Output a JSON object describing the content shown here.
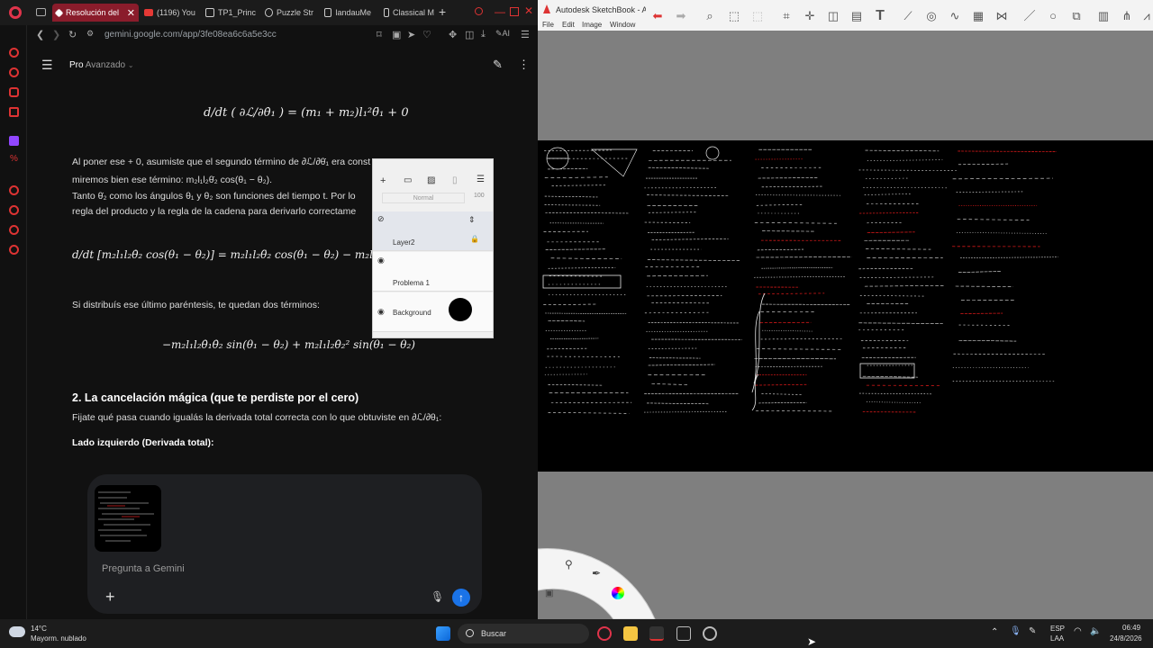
{
  "browser": {
    "tabs": [
      {
        "label": "Resolución del"
      },
      {
        "label": "(1196) You"
      },
      {
        "label": "TP1_Princ"
      },
      {
        "label": "Puzzle Str"
      },
      {
        "label": "landauMe"
      },
      {
        "label": "Classical M"
      }
    ],
    "url": "gemini.google.com/app/3fe08ea6c6a5e3cc",
    "ai_label": "AI"
  },
  "gemini": {
    "model_pro": "Pro",
    "model_mode": "Avanzado",
    "eq1": "d/dt ( ∂ℒ/∂θ̇₁ ) = (m₁ + m₂)l₁²θ̈₁ + 0",
    "p1_line1": "Al poner ese + 0, asumiste que el segundo término de ∂ℒ/∂θ̇₁ era const",
    "p1_line2": "miremos bien ese término: m₂l₁l₂θ̇₂ cos(θ₁ − θ₂).",
    "p1_line3": "Tanto θ̇₂ como los ángulos θ₁ y θ₂ son funciones del tiempo t. Por lo",
    "p1_line4": "regla del producto y la regla de la cadena para derivarlo correctame",
    "eq2": "d/dt [m₂l₁l₂θ̇₂ cos(θ₁ − θ₂)] = m₂l₁l₂θ̈₂ cos(θ₁ − θ₂) − m₂l₁l₂",
    "p2": "Si distribuís ese último paréntesis, te quedan dos términos:",
    "eq3": "−m₂l₁l₂θ̇₁θ̇₂ sin(θ₁ − θ₂) + m₂l₁l₂θ̇₂² sin(θ₁ − θ₂)",
    "heading": "2. La cancelación mágica (que te perdiste por el cero)",
    "p3": "Fijate qué pasa cuando igualás la derivada total correcta con lo que obtuviste en ∂ℒ/∂θ₁:",
    "p4": "Lado izquierdo (Derivada total):",
    "composer_placeholder": "Pregunta a Gemini"
  },
  "sketchbook": {
    "title": "Autodesk SketchBook - A",
    "menu": [
      "File",
      "Edit",
      "Image",
      "Window"
    ],
    "layer_panel": {
      "blend_mode": "Normal",
      "opacity": "100",
      "layers": [
        "Layer2",
        "Problema 1",
        "Background"
      ]
    }
  },
  "taskbar": {
    "temperature": "14°C",
    "weather": "Mayorm. nublado",
    "search_label": "Buscar",
    "lang1": "ESP",
    "lang2": "LAA",
    "time": "06:49",
    "date": "24/8/2026"
  },
  "colors": {
    "accent_tab": "#8a1c2b",
    "send_button": "#1a73e8",
    "canvas_bg": "#000000",
    "sketch_gray": "#7f7f7f"
  }
}
